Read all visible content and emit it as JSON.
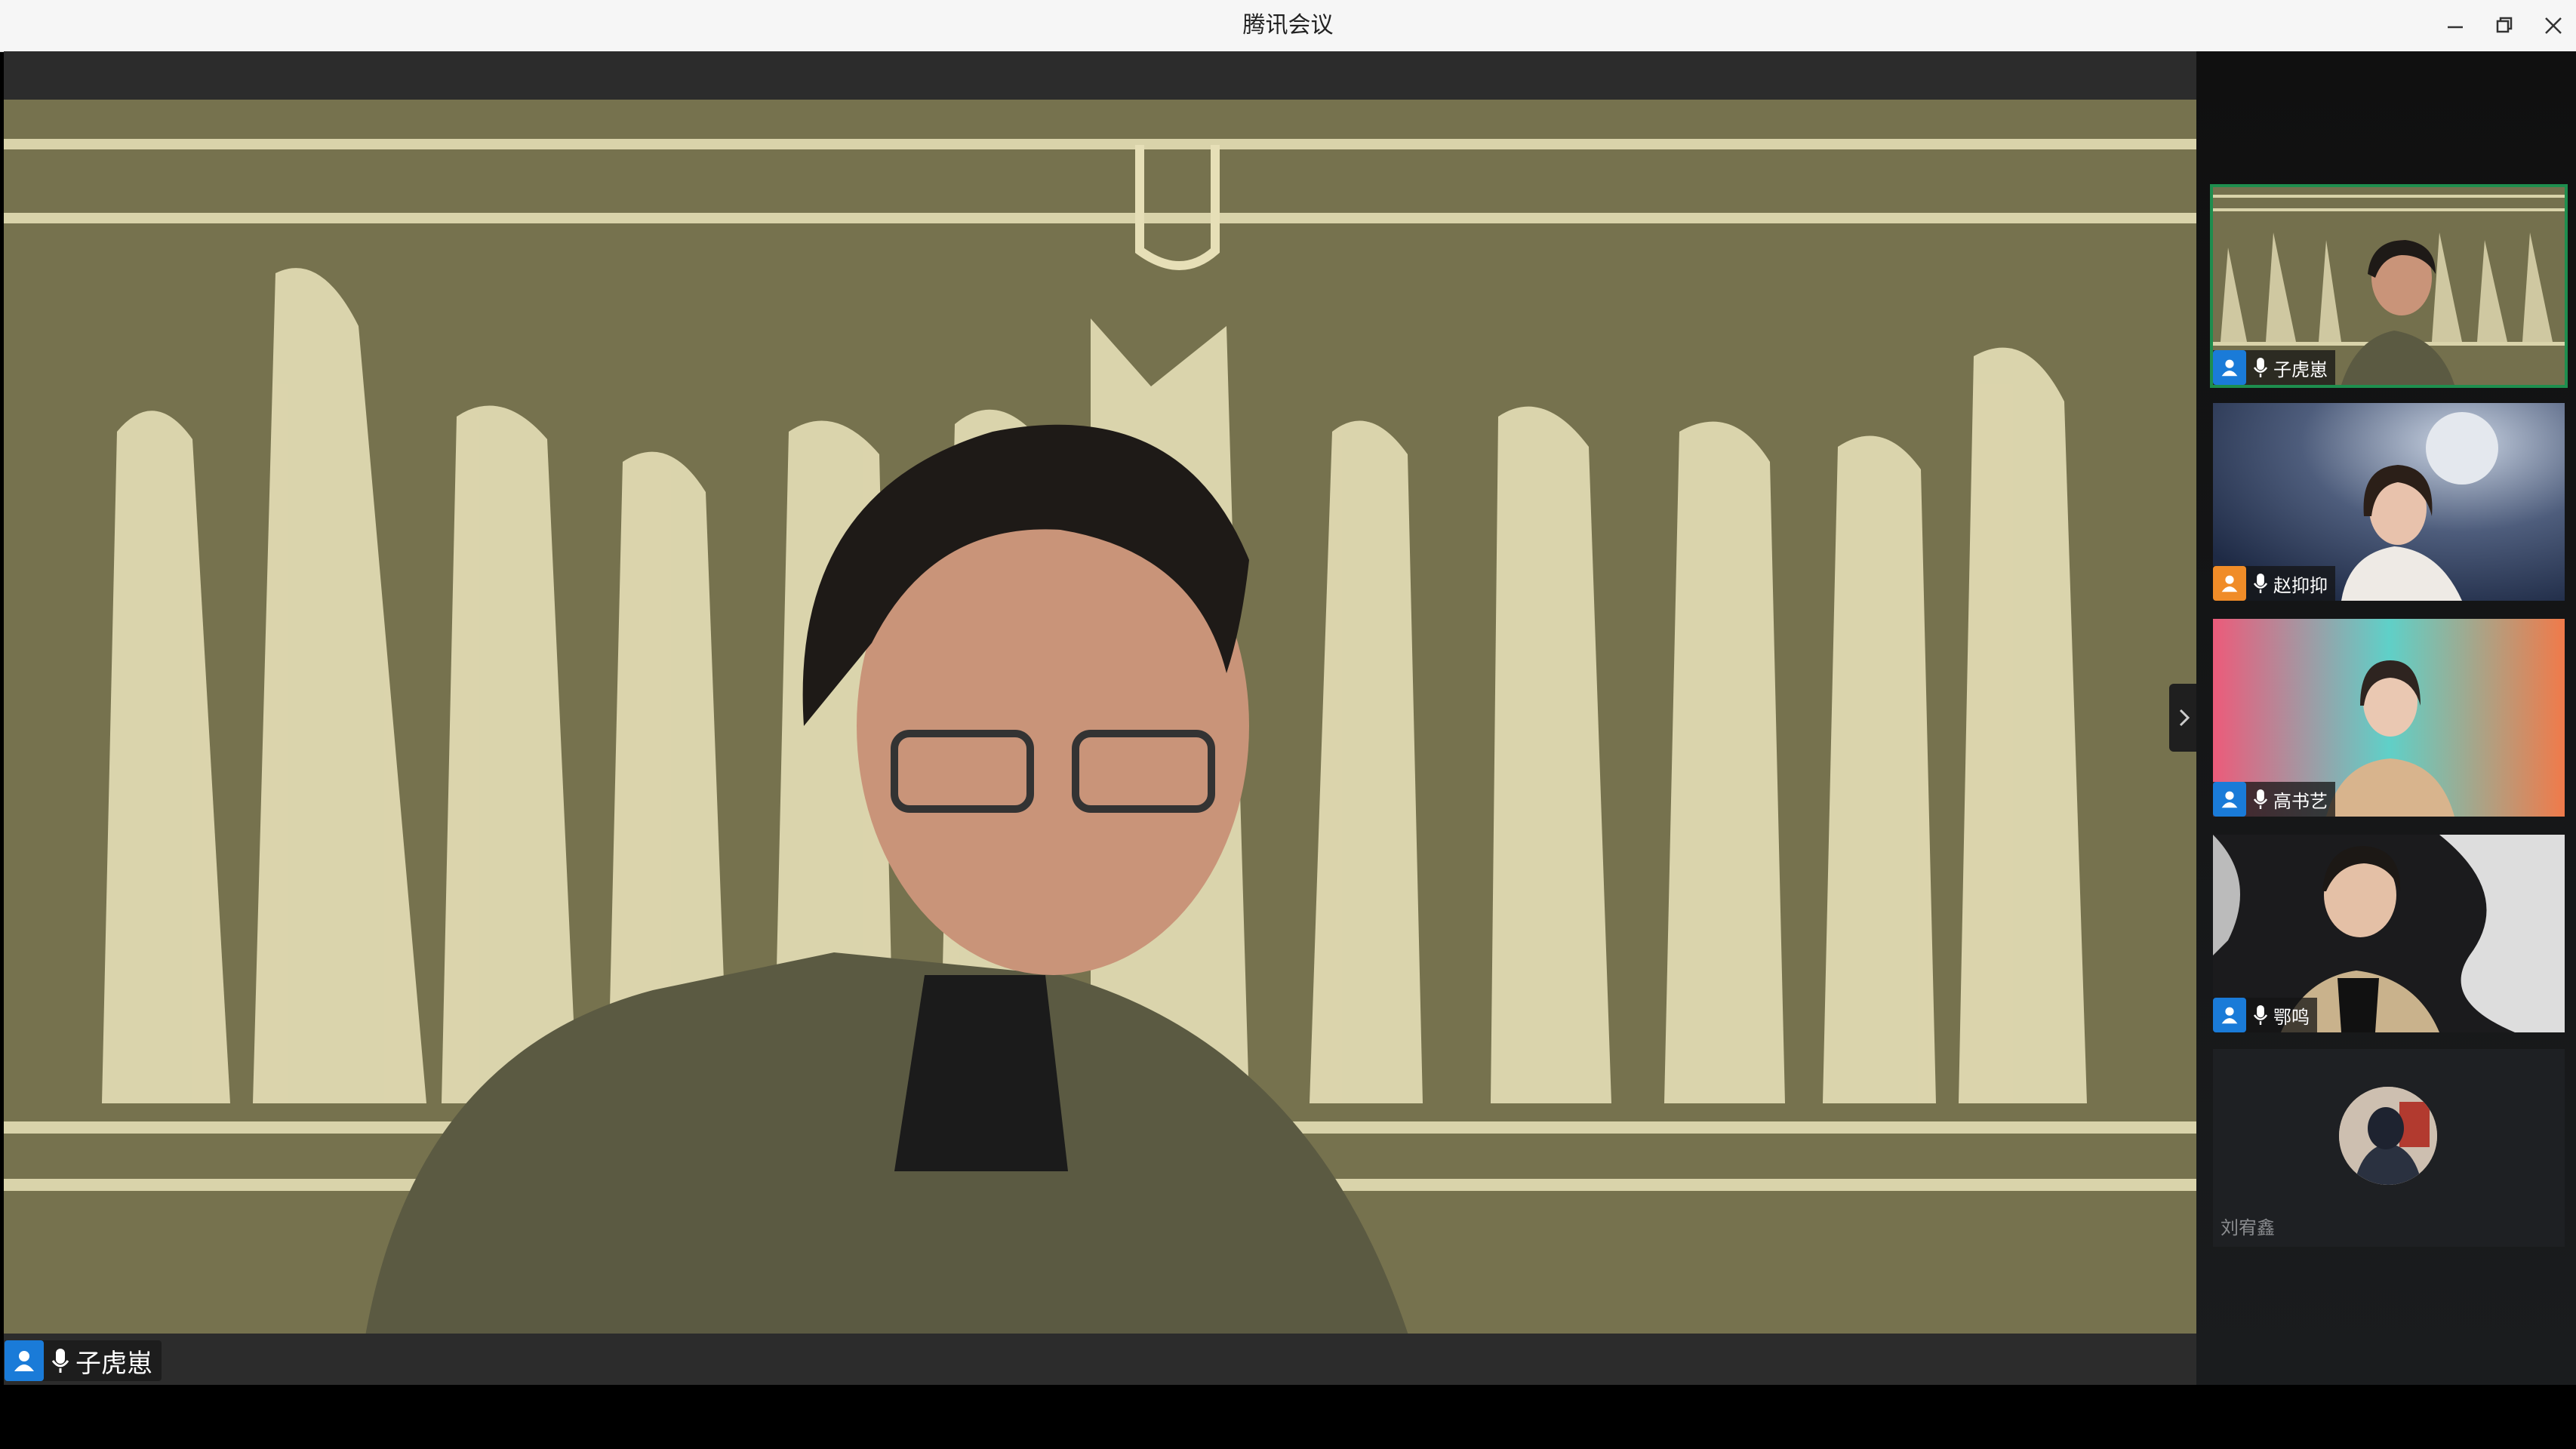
{
  "window": {
    "title": "腾讯会议",
    "minimize_icon": "minimize-icon",
    "restore_icon": "restore-icon",
    "close_icon": "close-icon"
  },
  "main_speaker": {
    "name": "子虎崽",
    "badge_color": "#1a7bd8"
  },
  "participants": [
    {
      "name": "子虎崽",
      "badge_color": "#1a7bd8",
      "active": true,
      "camera_on": true
    },
    {
      "name": "赵抑抑",
      "badge_color": "#f08c28",
      "active": false,
      "camera_on": true
    },
    {
      "name": "高书艺",
      "badge_color": "#1a7bd8",
      "active": false,
      "camera_on": true
    },
    {
      "name": "鄂鸣",
      "badge_color": "#1a7bd8",
      "active": false,
      "camera_on": true
    },
    {
      "name": "刘宥鑫",
      "camera_on": false
    }
  ],
  "colors": {
    "active_border": "#1e8e4e",
    "backdrop_olive": "#76724e",
    "sketch_cream": "#e6dfb7"
  }
}
